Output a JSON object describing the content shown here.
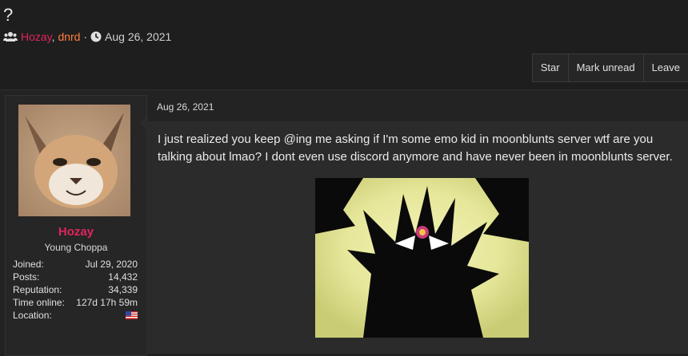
{
  "thread": {
    "title": "?",
    "participants": [
      "Hozay",
      "dnrd"
    ],
    "separator": ",",
    "dot": "·",
    "date": "Aug 26, 2021"
  },
  "actions": [
    "Star",
    "Mark unread",
    "Leave"
  ],
  "post": {
    "date": "Aug 26, 2021",
    "body": "I just realized you keep @ing me asking if I'm some emo kid in moonblunts server wtf are you talking about lmao? I dont even use discord anymore and have never been in moonblunts server.",
    "author": {
      "name": "Hozay",
      "title": "Young Choppa",
      "stats": [
        {
          "label": "Joined:",
          "value": "Jul 29, 2020"
        },
        {
          "label": "Posts:",
          "value": "14,432"
        },
        {
          "label": "Reputation:",
          "value": "34,339"
        },
        {
          "label": "Time online:",
          "value": "127d 17h 59m"
        },
        {
          "label": "Location:",
          "value": ""
        }
      ],
      "location_icon": "us-flag-icon"
    },
    "attachment_icon": "dark-demon-art-image"
  },
  "colors": {
    "background": "#1e1e1e",
    "username": "#e0245e",
    "second_user": "#ff7f3f"
  }
}
